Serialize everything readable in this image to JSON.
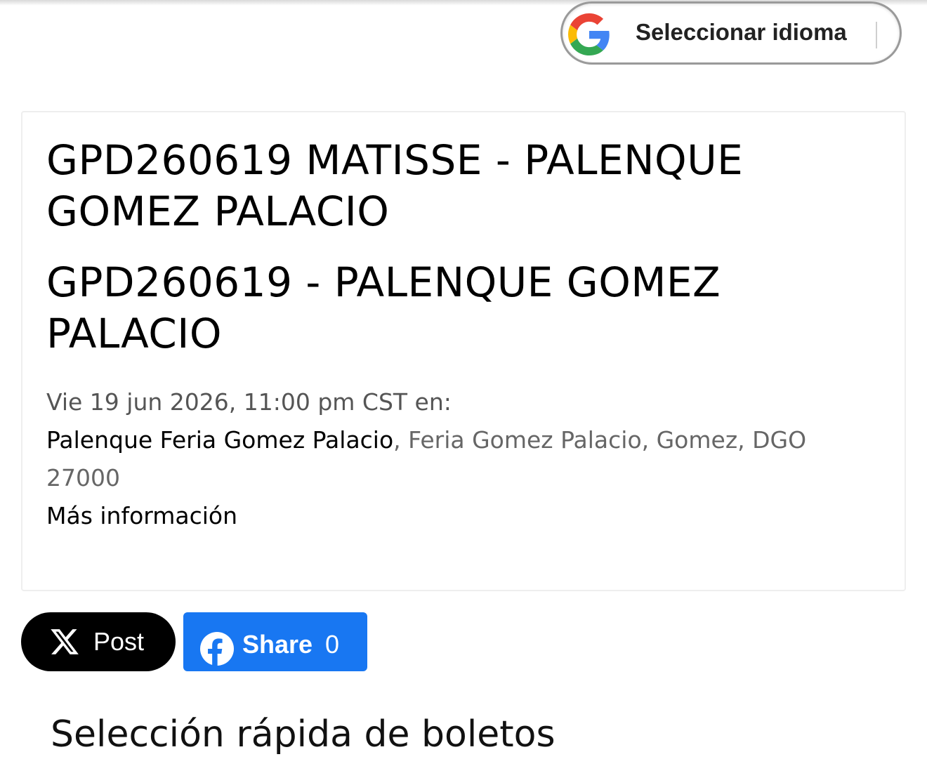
{
  "language_selector": {
    "label": "Seleccionar idioma",
    "icon": "google-g-icon"
  },
  "event": {
    "title": "GPD260619 MATISSE - PALENQUE GOMEZ PALACIO",
    "subtitle": "GPD260619 - PALENQUE GOMEZ PALACIO",
    "datetime": "Vie 19 jun 2026, 11:00 pm CST en:",
    "venue_name": "Palenque Feria Gomez Palacio",
    "venue_address": ", Feria Gomez Palacio, Gomez, DGO 27000",
    "more_info": "Más información"
  },
  "share": {
    "x_post_label": "Post",
    "x_icon": "x-logo-icon",
    "fb_share_label": "Share",
    "fb_share_count": "0",
    "fb_icon": "facebook-icon",
    "colors": {
      "x_background": "#000000",
      "fb_background": "#1877f2"
    }
  },
  "tickets": {
    "section_title": "Selección rápida de boletos"
  }
}
